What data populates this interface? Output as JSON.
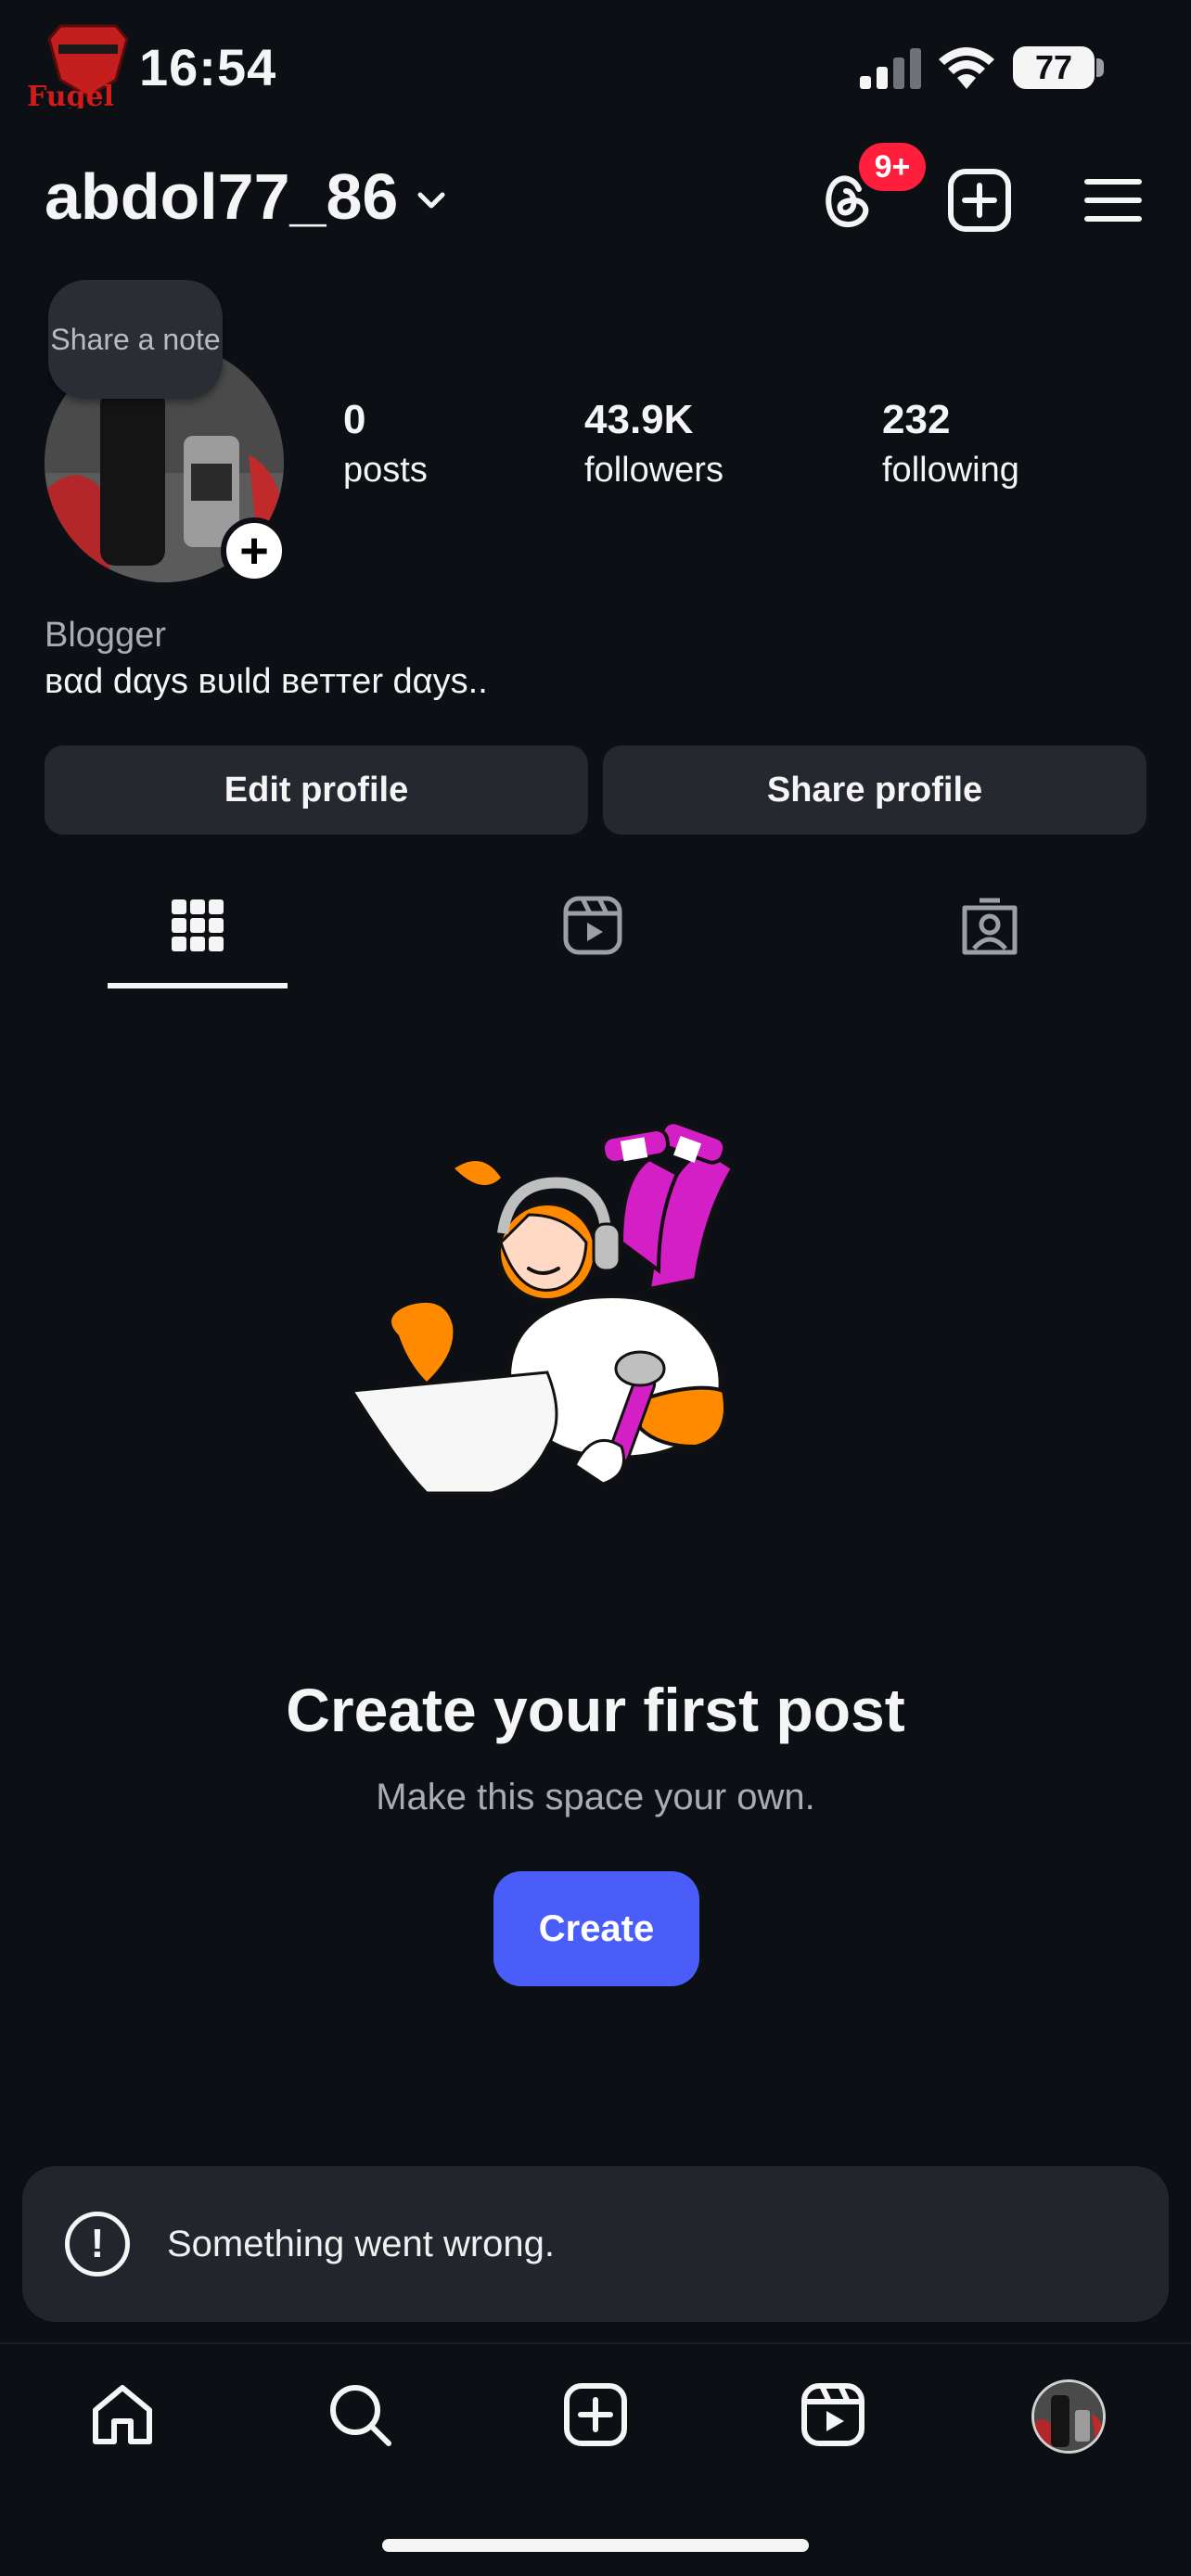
{
  "status_bar": {
    "time": "16:54",
    "battery": "77",
    "watermark_text": "Fugel",
    "icons": [
      "cellular-signal-icon",
      "wifi-icon",
      "battery-icon"
    ]
  },
  "header": {
    "username": "abdol77_86",
    "threads_badge": "9+",
    "icons": [
      "chevron-down-icon",
      "threads-icon",
      "new-post-icon",
      "menu-icon"
    ]
  },
  "profile": {
    "note_bubble": "Share a note",
    "stats": [
      {
        "value": "0",
        "label": "posts"
      },
      {
        "value": "43.9K",
        "label": "followers"
      },
      {
        "value": "232",
        "label": "following"
      }
    ],
    "category": "Blogger",
    "bio": "вαd dαуѕ вυιld вeттer dαуѕ.."
  },
  "actions": {
    "edit_profile": "Edit profile",
    "share_profile": "Share profile"
  },
  "tabs": [
    {
      "name": "grid",
      "icon": "grid-icon",
      "active": true
    },
    {
      "name": "reels",
      "icon": "reels-icon",
      "active": false
    },
    {
      "name": "tagged",
      "icon": "tagged-icon",
      "active": false
    }
  ],
  "empty_state": {
    "title": "Create your first post",
    "subtitle": "Make this space your own.",
    "button": "Create"
  },
  "toast": {
    "message": "Something went wrong."
  },
  "bottom_nav": [
    {
      "name": "home",
      "icon": "home-icon"
    },
    {
      "name": "search",
      "icon": "search-icon"
    },
    {
      "name": "create",
      "icon": "add-post-icon"
    },
    {
      "name": "reels",
      "icon": "reels-icon"
    },
    {
      "name": "profile",
      "icon": "profile-avatar"
    }
  ],
  "colors": {
    "background": "#0c0f14",
    "button": "#25282e",
    "accent": "#4a5df9",
    "badge": "#ff1f3d",
    "toast": "#22252b"
  }
}
